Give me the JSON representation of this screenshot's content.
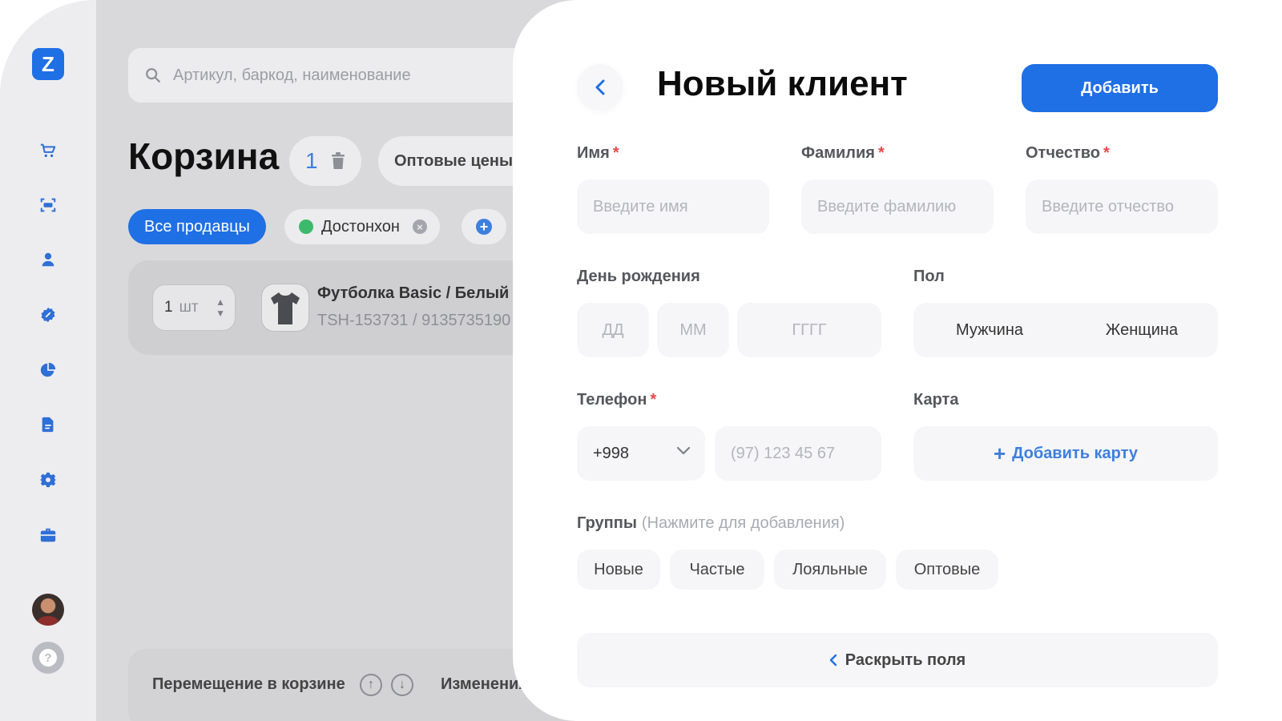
{
  "app": {
    "logo_letter": "Z",
    "accent_color": "#1f6fe5",
    "sidebar_icons": [
      "cart-icon",
      "scanner-icon",
      "user-icon",
      "discount-icon",
      "pie-chart-icon",
      "document-icon",
      "gear-icon",
      "briefcase-icon"
    ]
  },
  "background": {
    "search_placeholder": "Артикул, баркод, наименование",
    "cart_title": "Корзина",
    "cart_count": "1",
    "wholesale_label": "Оптовые цены",
    "sellers": {
      "all_label": "Все продавцы",
      "seller_name": "Достонхон"
    },
    "product": {
      "qty": "1",
      "unit": "шт",
      "name": "Футболка Basic / Белый /",
      "sku": "TSH-153731 / 9135735190"
    },
    "footer": {
      "move_label": "Перемещение в корзине",
      "change_label": "Изменения"
    }
  },
  "modal": {
    "title": "Новый клиент",
    "add_button": "Добавить",
    "required_mark": "*",
    "first_name": {
      "label": "Имя",
      "placeholder": "Введите имя"
    },
    "last_name": {
      "label": "Фамилия",
      "placeholder": "Введите фамилию"
    },
    "patronymic": {
      "label": "Отчество",
      "placeholder": "Введите отчество"
    },
    "birthday": {
      "label": "День рождения",
      "day_placeholder": "ДД",
      "month_placeholder": "ММ",
      "year_placeholder": "ГГГГ"
    },
    "gender": {
      "label": "Пол",
      "male": "Мужчина",
      "female": "Женщина"
    },
    "phone": {
      "label": "Телефон",
      "country_code": "+998",
      "placeholder": "(97) 123 45 67"
    },
    "card": {
      "label": "Карта",
      "add_label": "Добавить карту"
    },
    "groups": {
      "label": "Группы",
      "hint": "(Нажмите для добавления)",
      "items": [
        "Новые",
        "Частые",
        "Лояльные",
        "Оптовые"
      ]
    },
    "expand_label": "Раскрыть поля"
  }
}
